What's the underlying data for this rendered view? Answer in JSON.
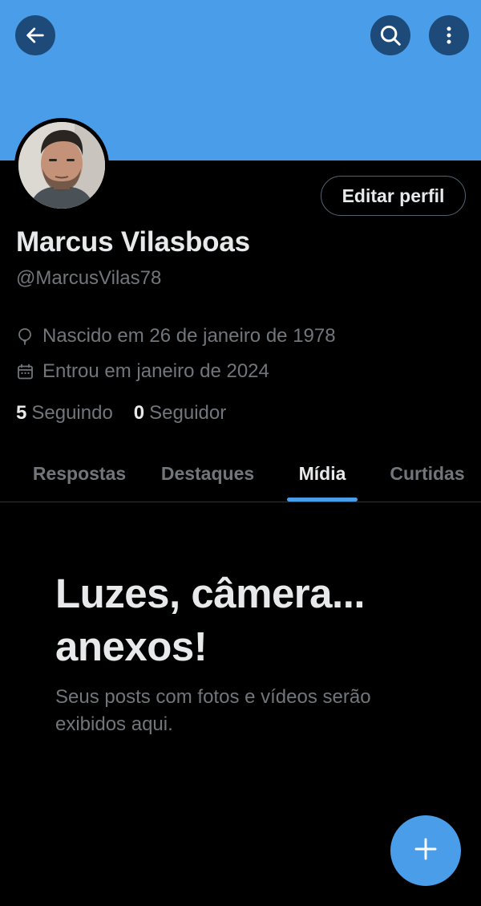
{
  "header": {
    "back_icon": "arrow-left-icon",
    "search_icon": "search-icon",
    "more_icon": "more-vertical-icon",
    "banner_color": "#4a9de9"
  },
  "profile": {
    "display_name": "Marcus Vilasboas",
    "handle": "@MarcusVilas78",
    "edit_label": "Editar perfil",
    "birth": "Nascido em 26 de janeiro de 1978",
    "birth_icon": "balloon-icon",
    "joined": "Entrou em janeiro de 2024",
    "joined_icon": "calendar-icon",
    "following_count": "5",
    "following_label": "Seguindo",
    "followers_count": "0",
    "followers_label": "Seguidor"
  },
  "tabs": [
    {
      "label": "Respostas",
      "active": false
    },
    {
      "label": "Destaques",
      "active": false
    },
    {
      "label": "Mídia",
      "active": true
    },
    {
      "label": "Curtidas",
      "active": false
    }
  ],
  "empty_state": {
    "title": "Luzes, câmera... anexos!",
    "subtitle": "Seus posts com fotos e vídeos serão exibidos aqui."
  },
  "fab": {
    "icon": "plus-icon"
  },
  "colors": {
    "accent": "#4a9de9",
    "background": "#000000",
    "muted_text": "#71767b"
  }
}
